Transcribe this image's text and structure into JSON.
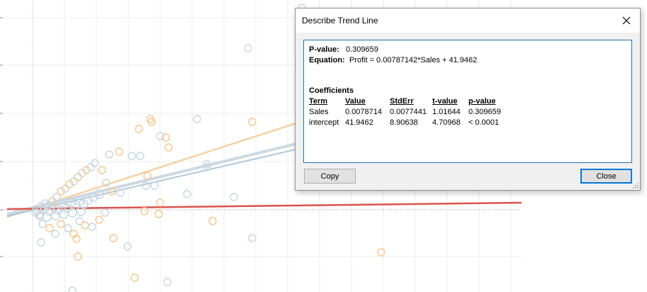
{
  "dialog": {
    "title": "Describe Trend Line",
    "close_icon": "close-icon",
    "pvalue_label": "P-value:",
    "pvalue": "0.309659",
    "equation_label": "Equation:",
    "equation": "Profit = 0.00787142*Sales + 41.9462",
    "coefficients_heading": "Coefficients",
    "columns": [
      "Term",
      "Value",
      "StdErr",
      "t-value",
      "p-value"
    ],
    "rows": [
      [
        "Sales",
        "0.0078714",
        "0.0077441",
        "1.01644",
        "0.309659"
      ],
      [
        "intercept",
        "41.9462",
        "8.90638",
        "4.70968",
        "< 0.0001"
      ]
    ],
    "copy_label": "Copy",
    "close_label": "Close"
  },
  "colors": {
    "accent_border": "#1e73b8",
    "trend_red": "#d9534f",
    "trend_orange": "#f5c68f",
    "trend_blue": "#a9c4d6"
  }
}
